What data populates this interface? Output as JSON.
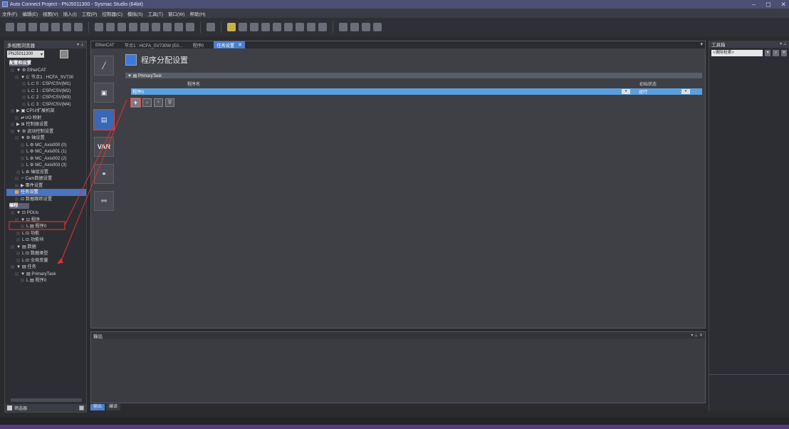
{
  "window": {
    "title": "Auto Connect Project - PNJ5011300 - Sysmac Studio (64bit)",
    "minimize": "–",
    "maximize": "◻",
    "close": "✕"
  },
  "menu": [
    "文件(F)",
    "编辑(E)",
    "视图(V)",
    "插入(I)",
    "工程(P)",
    "控制器(C)",
    "模拟(S)",
    "工具(T)",
    "窗口(W)",
    "帮助(H)"
  ],
  "left": {
    "header": "多视图浏览器",
    "pin": "▾ ⊥",
    "device": "PNJ5011300",
    "tree": [
      "配置和设置",
      "▼ ⚙ EtherCAT",
      "▼ ⊏ 节点1 : HCFA_SV730",
      "L ⊏ 0 : CSP/CSV(M1)",
      "L ⊏ 1 : CSP/CSV(M2)",
      "L ⊏ 2 : CSP/CSV(M3)",
      "L ⊏ 3 : CSP/CSV(M4)",
      "▶ ▣ CPU/扩展机架",
      "⇄ I/O 映射",
      "▶ ⊞ 控制器设置",
      "▼ ⚙ 运动控制设置",
      "▼ ⚙ 轴设置",
      "L ⚙ MC_Axis000 (0)",
      "L ⚙ MC_Axis001 (1)",
      "L ⚙ MC_Axis002 (2)",
      "L ⚙ MC_Axis003 (3)",
      "L ⚙ 轴组设置",
      "♂ Cam数据设置",
      "▶ 事件设置",
      "任务设置",
      "⊡ 数据跟踪设置",
      "编程",
      "▼ ⊡ POUs",
      "▼ ⊡ 程序",
      "L ▤ 程序0",
      "L ⊡ 功能",
      "L ⊡ 功能块",
      "▼ ▤ 数据",
      "L ⊡ 数据类型",
      "L ⊡ 全局变量",
      "▼ ▤ 任务",
      "▼ ▤ PrimaryTask",
      "L ▤ 程序0"
    ],
    "bottom_label": "筛选器"
  },
  "editor": {
    "tabs": [
      "EtherCAT",
      "节点1 : HCFA_SV730W (E0...",
      "程序0",
      "任务设置"
    ],
    "close": "✕",
    "dropdown": "▾",
    "page_title": "程序分配设置",
    "task_section": "▼ ▤ PrimaryTask",
    "col_program": "程序名",
    "col_state": "初始状态",
    "row_program": "程序0",
    "row_state": "运行",
    "var_label": "VAR",
    "add": "+",
    "caret": "▾"
  },
  "output": {
    "header": "输出",
    "pin": "▾ ⊥ ✕",
    "tabs": [
      "输出",
      "编译"
    ]
  },
  "right": {
    "header": "工具箱",
    "pin": "▾ ⊥",
    "search_placeholder": "<清除检索>",
    "search_icon": "⌕",
    "close": "✕"
  }
}
